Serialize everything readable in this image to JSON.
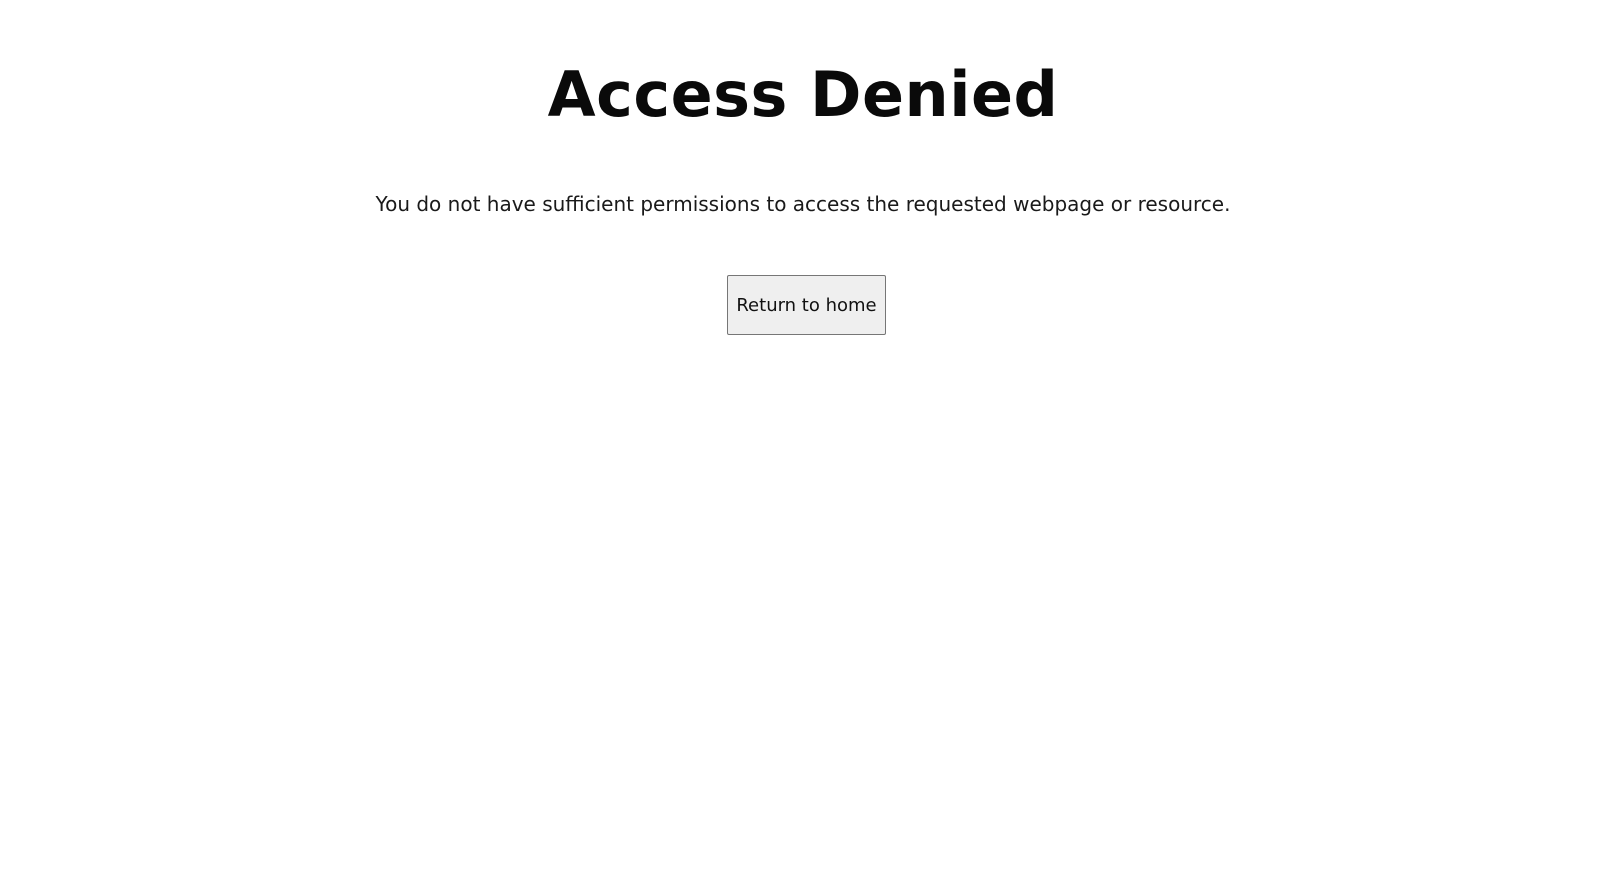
{
  "page": {
    "title": "Access Denied",
    "message": "You do not have sufficient permissions to access the requested webpage or resource.",
    "button_label": "Return to home"
  }
}
